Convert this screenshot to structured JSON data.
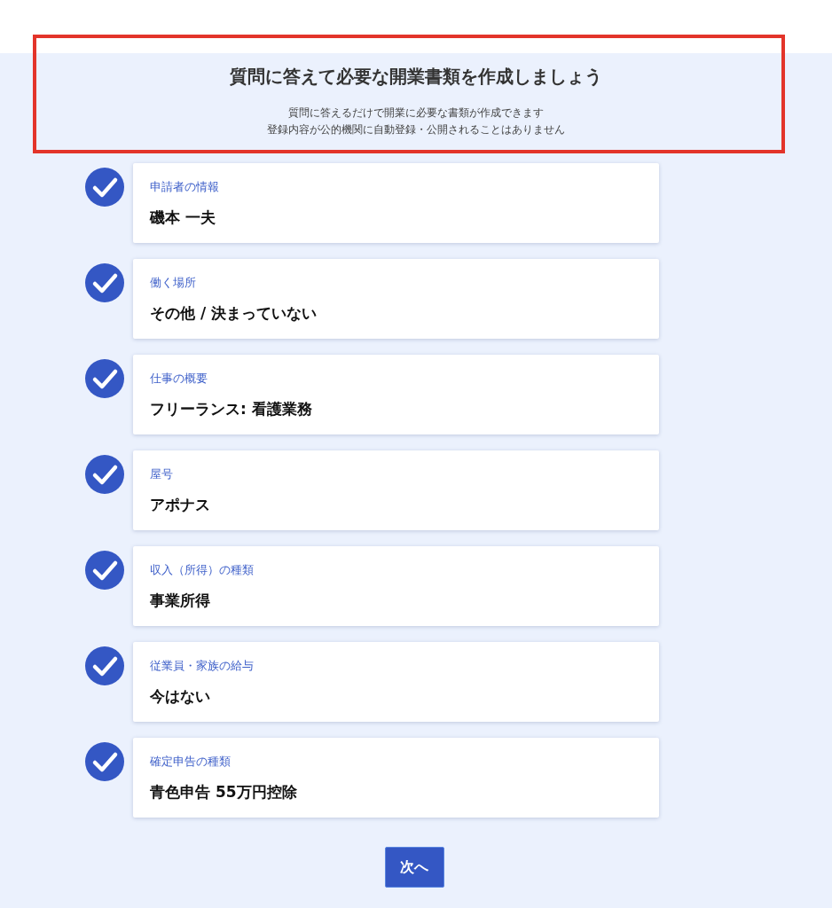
{
  "header": {
    "title": "質問に答えて必要な開業書類を作成しましょう",
    "description": [
      "質問に答えるだけで開業に必要な書類が作成できます",
      "登録内容が公的機関に自動登録・公開されることはありません"
    ],
    "highlighted": true
  },
  "steps": [
    {
      "label": "申請者の情報",
      "value": "磯本 一夫",
      "done": true
    },
    {
      "label": "働く場所",
      "value": "その他 / 決まっていない",
      "done": true
    },
    {
      "label": "仕事の概要",
      "value": "フリーランス: 看護業務",
      "done": true
    },
    {
      "label": "屋号",
      "value": "アポナス",
      "done": true
    },
    {
      "label": "収入（所得）の種類",
      "value": "事業所得",
      "done": true
    },
    {
      "label": "従業員・家族の給与",
      "value": "今はない",
      "done": true
    },
    {
      "label": "確定申告の種類",
      "value": "青色申告 55万円控除",
      "done": true
    }
  ],
  "next_button": "次へ"
}
